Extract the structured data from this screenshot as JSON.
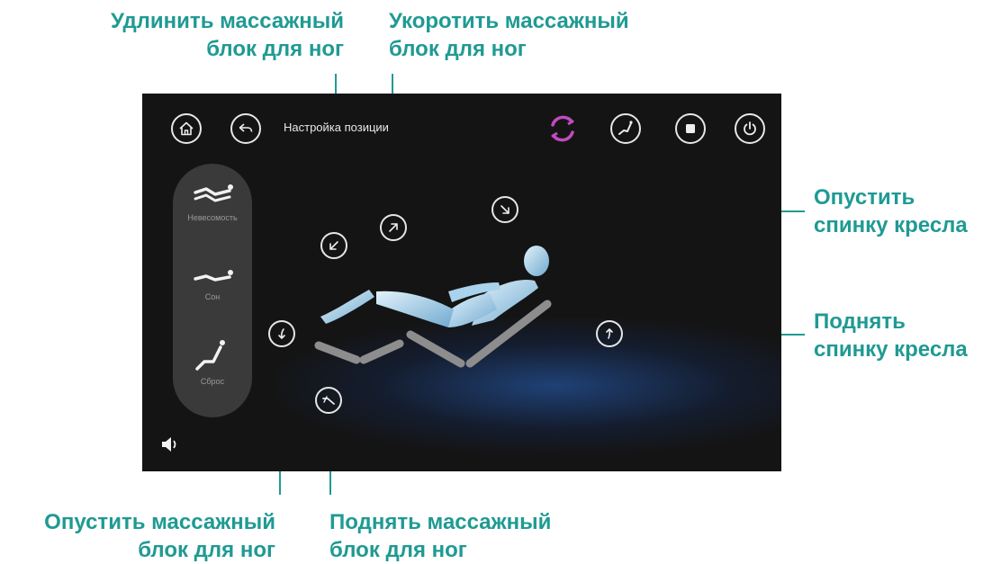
{
  "screen": {
    "title": "Настройка позиции",
    "modes": [
      {
        "label": "Невесомость",
        "icon": "zero-gravity-icon"
      },
      {
        "label": "Сон",
        "icon": "sleep-icon"
      },
      {
        "label": "Сброс",
        "icon": "reset-chair-icon"
      }
    ],
    "header_icons": [
      "home-icon",
      "back-icon",
      "sync-icon",
      "chair-position-icon",
      "stop-icon",
      "power-icon"
    ],
    "colors": {
      "accent": "#c24bbf",
      "background": "#141414",
      "panel": "#3a3a3a"
    }
  },
  "callouts": {
    "extend_leg_block": [
      "Удлинить массажный",
      "блок для ног"
    ],
    "shorten_leg_block": [
      "Укоротить массажный",
      "блок для ног"
    ],
    "lower_backrest": [
      "Опустить",
      "спинку кресла"
    ],
    "raise_backrest": [
      "Поднять",
      "спинку кресла"
    ],
    "lower_leg_block": [
      "Опустить массажный",
      "блок для ног"
    ],
    "raise_leg_block": [
      "Поднять массажный",
      "блок для ног"
    ]
  },
  "callout_color": "#1f9a93"
}
